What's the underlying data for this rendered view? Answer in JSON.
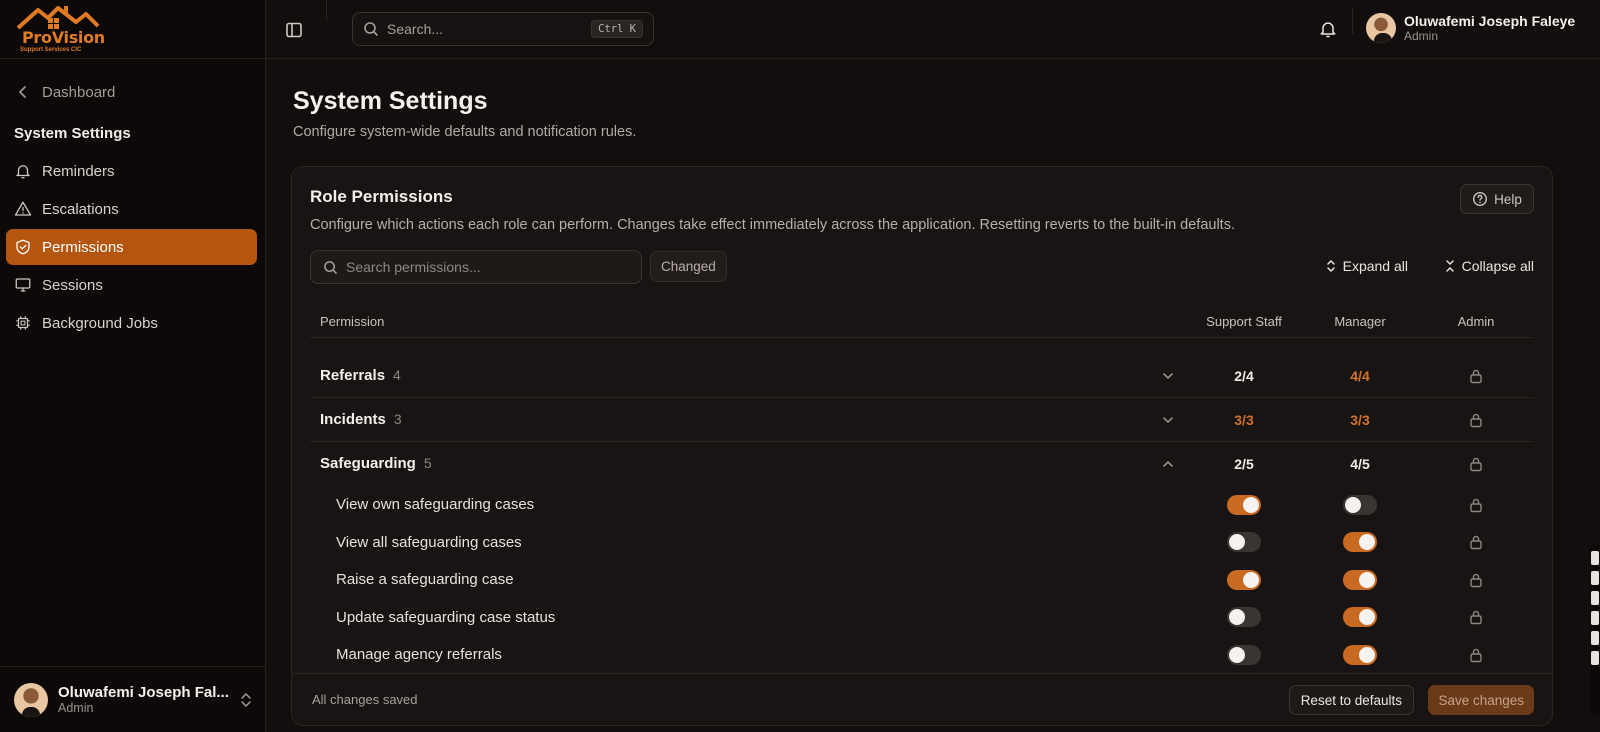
{
  "brand": {
    "name": "ProVision",
    "subtitle": "Support Services CIC",
    "accent": "#e07b23"
  },
  "sidebar": {
    "back_label": "Dashboard",
    "section_title": "System Settings",
    "items": [
      {
        "label": "Reminders",
        "icon": "bell-icon"
      },
      {
        "label": "Escalations",
        "icon": "warning-triangle-icon"
      },
      {
        "label": "Permissions",
        "icon": "shield-check-icon",
        "active": true
      },
      {
        "label": "Sessions",
        "icon": "monitor-icon"
      },
      {
        "label": "Background Jobs",
        "icon": "cpu-chip-icon"
      }
    ],
    "user": {
      "name": "Oluwafemi Joseph Fal...",
      "role": "Admin"
    }
  },
  "topbar": {
    "search_placeholder": "Search...",
    "shortcut": "Ctrl K",
    "user": {
      "name": "Oluwafemi Joseph Faleye",
      "role": "Admin"
    }
  },
  "page": {
    "title": "System Settings",
    "subtitle": "Configure system-wide defaults and notification rules."
  },
  "permissions_card": {
    "title": "Role Permissions",
    "description": "Configure which actions each role can perform. Changes take effect immediately across the application. Resetting reverts to the built-in defaults.",
    "help_label": "Help",
    "search_placeholder": "Search permissions...",
    "changed_label": "Changed",
    "expand_all_label": "Expand all",
    "collapse_all_label": "Collapse all",
    "columns": {
      "permission": "Permission",
      "support_staff": "Support Staff",
      "manager": "Manager",
      "admin": "Admin"
    },
    "groups": [
      {
        "name": "Referrals",
        "count": "4",
        "support_staff": "2/4",
        "manager": "4/4",
        "manager_full": true,
        "support_full": false,
        "expanded": false
      },
      {
        "name": "Incidents",
        "count": "3",
        "support_staff": "3/3",
        "manager": "3/3",
        "manager_full": true,
        "support_full": true,
        "expanded": false
      },
      {
        "name": "Safeguarding",
        "count": "5",
        "support_staff": "2/5",
        "manager": "4/5",
        "manager_full": false,
        "support_full": false,
        "expanded": true
      }
    ],
    "safeguarding_permissions": [
      {
        "label": "View own safeguarding cases",
        "support_staff": true,
        "manager": false
      },
      {
        "label": "View all safeguarding cases",
        "support_staff": false,
        "manager": true
      },
      {
        "label": "Raise a safeguarding case",
        "support_staff": true,
        "manager": true
      },
      {
        "label": "Update safeguarding case status",
        "support_staff": false,
        "manager": true
      },
      {
        "label": "Manage agency referrals",
        "support_staff": false,
        "manager": true
      }
    ],
    "footer": {
      "status": "All changes saved",
      "reset_label": "Reset to defaults",
      "save_label": "Save changes"
    }
  }
}
